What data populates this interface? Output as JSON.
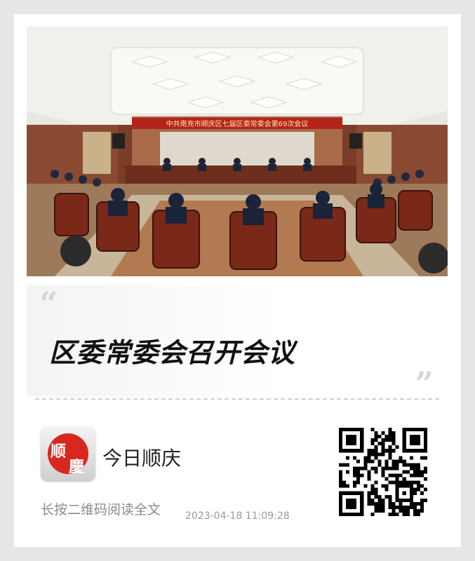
{
  "photo": {
    "banner_text": "中共南充市顺庆区七届区委常委会第69次会议",
    "banner_color": "#b3231c"
  },
  "article": {
    "open_quote": "“",
    "close_quote": "”",
    "headline": "区委常委会召开会议"
  },
  "account": {
    "logo_chars": [
      "顺",
      "慶"
    ],
    "name": "今日顺庆",
    "seal_color": "#d8281e"
  },
  "footer": {
    "hint": "长按二维码阅读全文",
    "timestamp": "2023-04-18 11:09:28"
  }
}
